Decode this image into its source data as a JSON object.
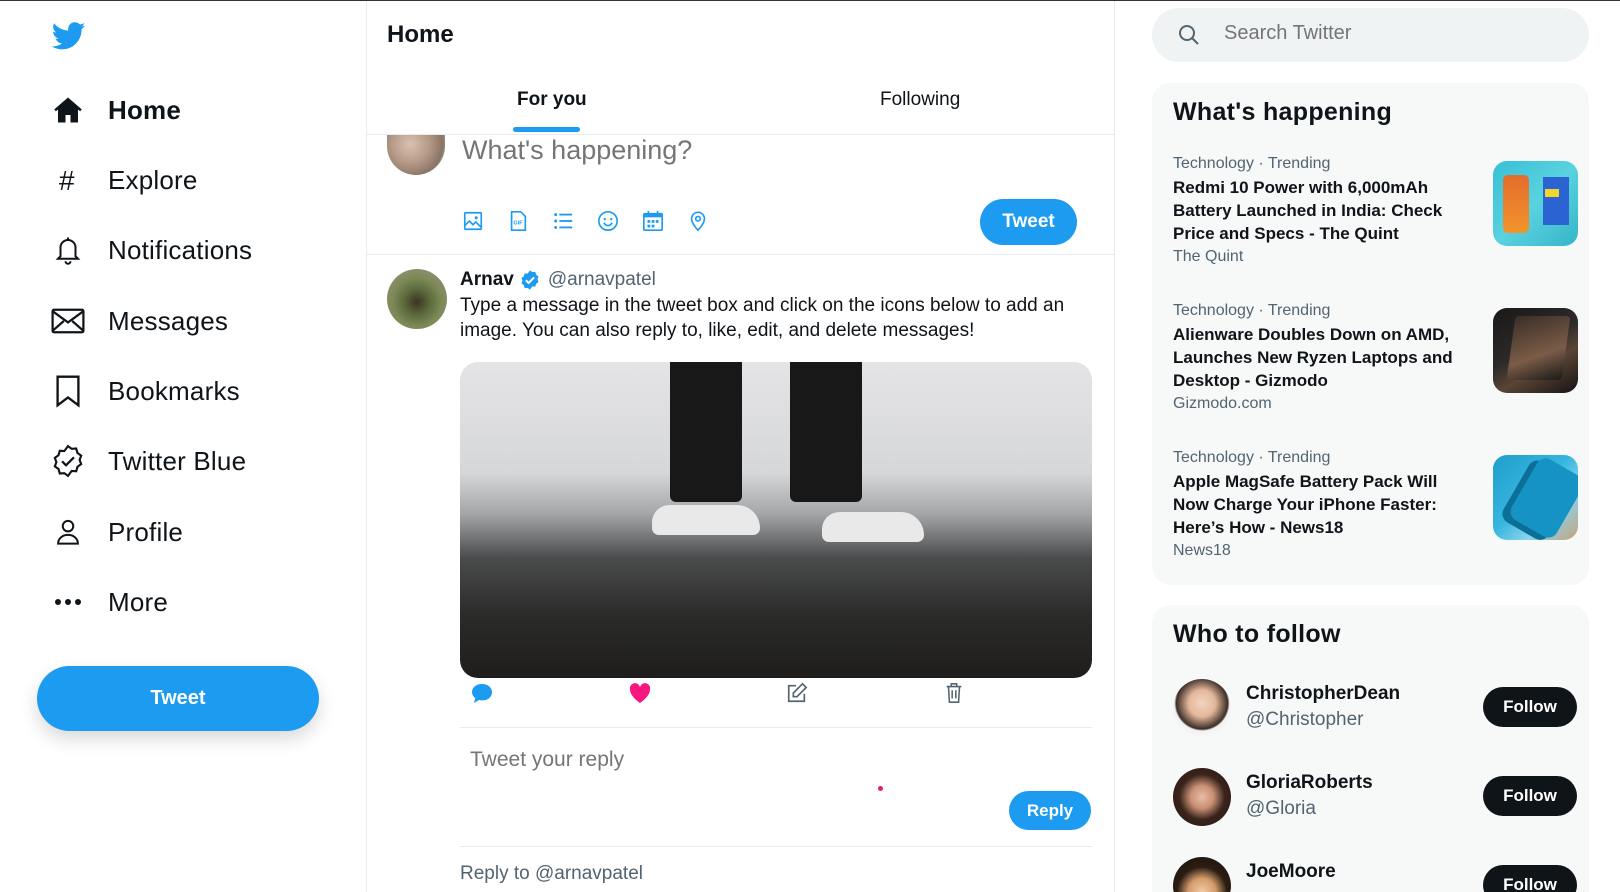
{
  "nav": {
    "items": [
      {
        "label": "Home",
        "icon": "home-icon"
      },
      {
        "label": "Explore",
        "icon": "hashtag-icon"
      },
      {
        "label": "Notifications",
        "icon": "bell-icon"
      },
      {
        "label": "Messages",
        "icon": "envelope-icon"
      },
      {
        "label": "Bookmarks",
        "icon": "bookmark-icon"
      },
      {
        "label": "Twitter Blue",
        "icon": "verified-badge-icon"
      },
      {
        "label": "Profile",
        "icon": "person-icon"
      },
      {
        "label": "More",
        "icon": "more-dots-icon"
      }
    ],
    "tweet_button": "Tweet"
  },
  "main": {
    "title": "Home",
    "tabs": [
      {
        "label": "For you",
        "active": true
      },
      {
        "label": "Following",
        "active": false
      }
    ],
    "composer": {
      "placeholder": "What's happening?",
      "tools": [
        "image-icon",
        "gif-icon",
        "poll-list-icon",
        "emoji-icon",
        "schedule-calendar-icon",
        "location-pin-icon"
      ],
      "tweet_button": "Tweet"
    },
    "tweet": {
      "name": "Arnav",
      "handle": "@arnavpatel",
      "text": "Type a message in the tweet box and click on the icons below to add an image. You can also reply to, like, edit, and delete messages!",
      "actions": [
        "comment-icon",
        "heart-icon",
        "edit-icon",
        "trash-icon"
      ],
      "reply_placeholder": "Tweet your reply",
      "reply_button": "Reply",
      "reply_to": "Reply to @arnavpatel"
    }
  },
  "right": {
    "search_placeholder": "Search Twitter",
    "trends_title": "What's happening",
    "trends": [
      {
        "meta": "Technology · Trending",
        "headline": "Redmi 10 Power with 6,000mAh Battery Launched in India: Check Price and Specs - The Quint",
        "source": "The Quint"
      },
      {
        "meta": "Technology · Trending",
        "headline": "Alienware Doubles Down on AMD, Launches New Ryzen Laptops and Desktop - Gizmodo",
        "source": "Gizmodo.com"
      },
      {
        "meta": "Technology · Trending",
        "headline": "Apple MagSafe Battery Pack Will Now Charge Your iPhone Faster: Here’s How - News18",
        "source": "News18"
      }
    ],
    "follow_title": "Who to follow",
    "follow": [
      {
        "name": "ChristopherDean",
        "handle": "@Christopher",
        "button": "Follow"
      },
      {
        "name": "GloriaRoberts",
        "handle": "@Gloria",
        "button": "Follow"
      },
      {
        "name": "JoeMoore",
        "handle": "",
        "button": "Follow"
      }
    ]
  },
  "colors": {
    "accent": "#1d9bf0",
    "like": "#f91880",
    "text": "#0f1419",
    "muted": "#536471"
  }
}
